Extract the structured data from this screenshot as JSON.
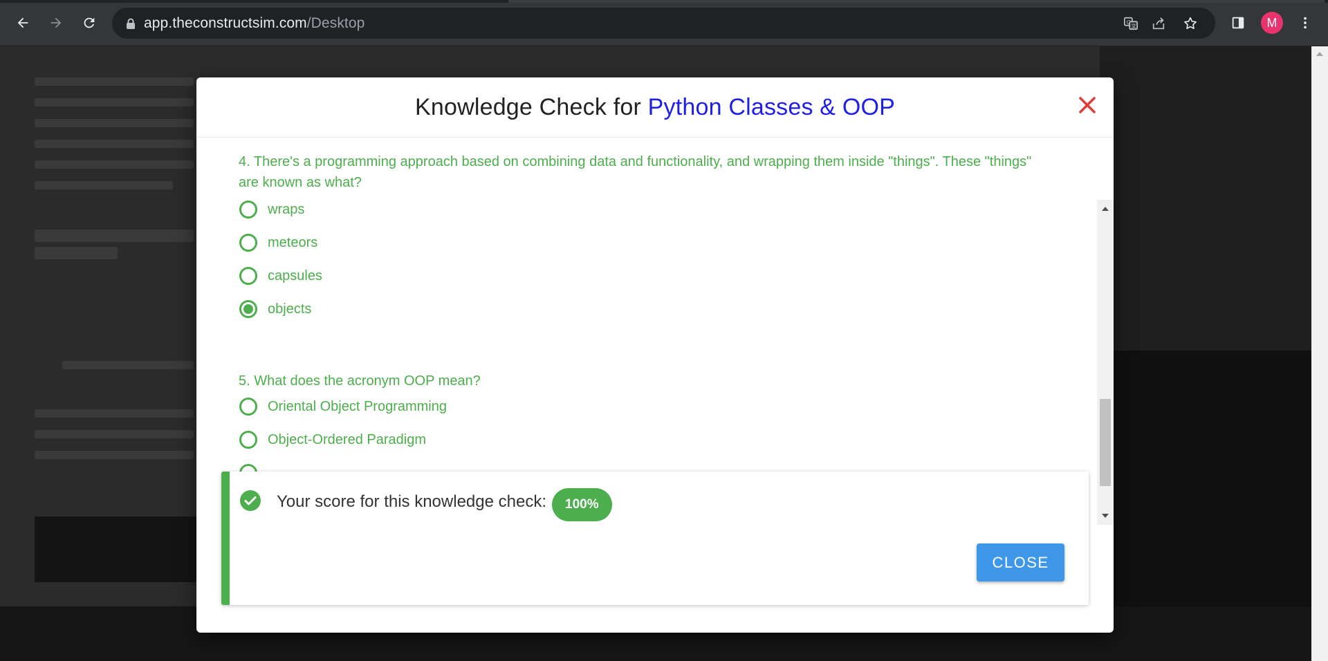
{
  "browser": {
    "url_host": "app.theconstructsim.com",
    "url_path": "/Desktop",
    "avatar_letter": "M"
  },
  "modal": {
    "title_prefix": "Knowledge Check for ",
    "title_highlight": "Python Classes & OOP",
    "questions": [
      {
        "text": "4. There's a programming approach based on combining data and functionality, and wrapping them inside \"things\". These \"things\" are known as what?",
        "options": [
          {
            "label": "wraps",
            "selected": false
          },
          {
            "label": "meteors",
            "selected": false
          },
          {
            "label": "capsules",
            "selected": false
          },
          {
            "label": "objects",
            "selected": true
          }
        ]
      },
      {
        "text": "5. What does the acronym OOP mean?",
        "options": [
          {
            "label": "Oriental Object Programming",
            "selected": false
          },
          {
            "label": "Object-Ordered Paradigm",
            "selected": false
          }
        ]
      }
    ],
    "score": {
      "text": "Your score for this knowledge check:",
      "value": "100%",
      "close_label": "CLOSE"
    }
  },
  "colors": {
    "accent_green": "#4cae4c",
    "title_blue": "#1f1fe8",
    "close_red": "#e53935",
    "button_blue": "#3e97e8"
  }
}
